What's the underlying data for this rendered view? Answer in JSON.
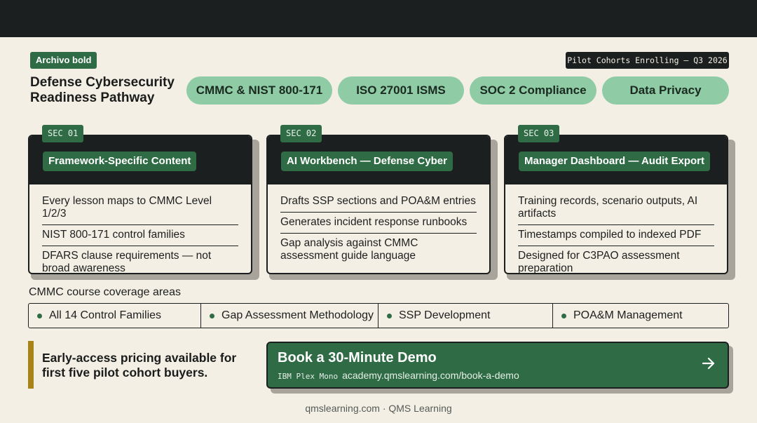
{
  "header": {
    "brand_tag": "Archivo bold",
    "title_line1": "Defense Cybersecurity",
    "title_line2": "Readiness Pathway",
    "pilot_badge": "Pilot Cohorts Enrolling — Q3 2026"
  },
  "pills": [
    {
      "label": "CMMC & NIST 800-171"
    },
    {
      "label": "ISO 27001 ISMS"
    },
    {
      "label": "SOC 2 Compliance"
    },
    {
      "label": "Data Privacy"
    }
  ],
  "cards": [
    {
      "sec": "SEC 01",
      "title": "Framework-Specific Content",
      "items": [
        "Every lesson maps to CMMC Level 1/2/3",
        "NIST 800-171 control families",
        "DFARS clause requirements — not broad awareness"
      ]
    },
    {
      "sec": "SEC 02",
      "title": "AI Workbench — Defense Cyber",
      "items": [
        "Drafts SSP sections and POA&M entries",
        "Generates incident response runbooks",
        "Gap analysis against CMMC assessment guide language"
      ]
    },
    {
      "sec": "SEC 03",
      "title": "Manager Dashboard — Audit Export",
      "items": [
        "Training records, scenario outputs, AI artifacts",
        "Timestamps compiled to indexed PDF",
        "Designed for C3PAO assessment preparation"
      ]
    }
  ],
  "coverage": {
    "label": "CMMC course coverage areas",
    "items": [
      "All 14 Control Families",
      "Gap Assessment Methodology",
      "SSP Development",
      "POA&M Management"
    ]
  },
  "promo": {
    "line1": "Early-access pricing available for",
    "line2": "first five pilot cohort buyers."
  },
  "cta": {
    "title": "Book a 30-Minute Demo",
    "font_note": "IBM Plex Mono",
    "url": "academy.qmslearning.com/book-a-demo",
    "icon": "arrow-right-icon"
  },
  "footer": {
    "text": "qmslearning.com · QMS Learning"
  },
  "colors": {
    "dark": "#1c1f1f",
    "green": "#2f6b45",
    "mint": "#8fcca6",
    "cream": "#f4efe4",
    "gold": "#a88418"
  }
}
